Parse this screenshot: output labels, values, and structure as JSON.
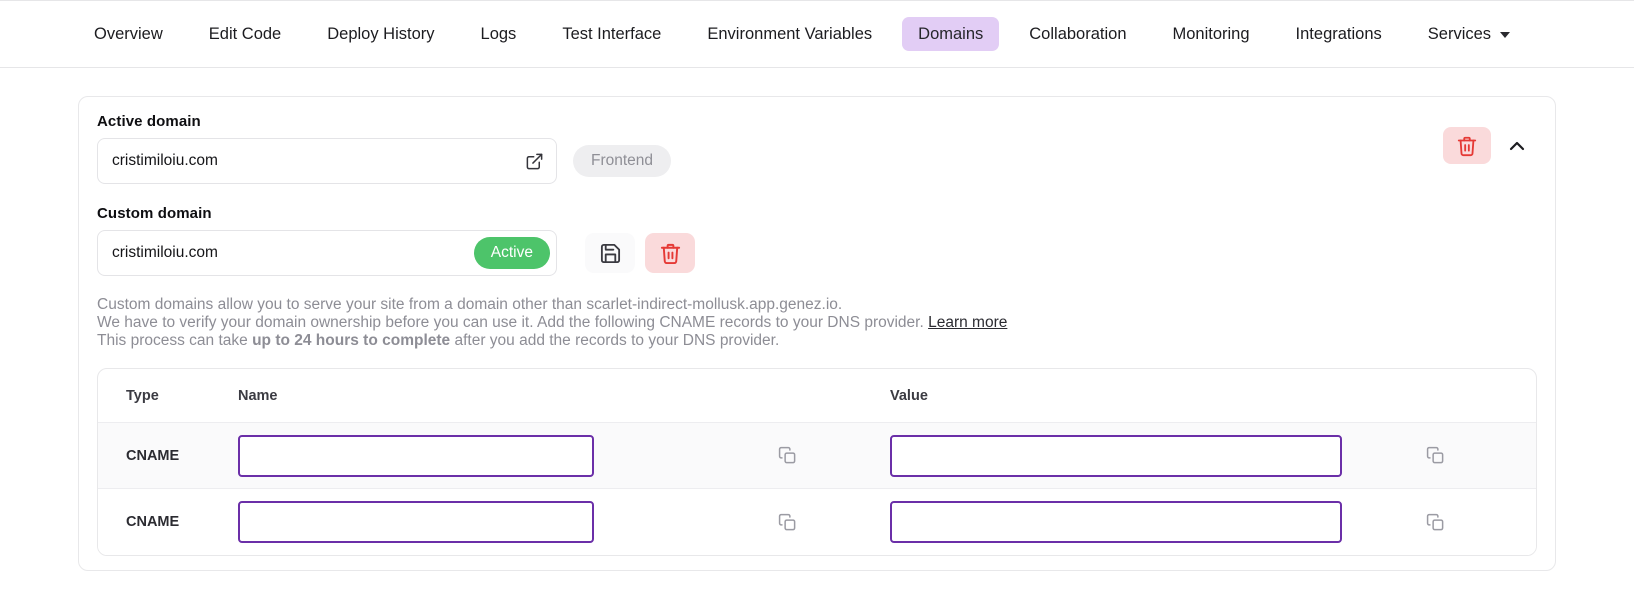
{
  "nav": {
    "items": [
      {
        "label": "Overview",
        "active": false
      },
      {
        "label": "Edit Code",
        "active": false
      },
      {
        "label": "Deploy History",
        "active": false
      },
      {
        "label": "Logs",
        "active": false
      },
      {
        "label": "Test Interface",
        "active": false
      },
      {
        "label": "Environment Variables",
        "active": false
      },
      {
        "label": "Domains",
        "active": true
      },
      {
        "label": "Collaboration",
        "active": false
      },
      {
        "label": "Monitoring",
        "active": false
      },
      {
        "label": "Integrations",
        "active": false
      },
      {
        "label": "Services",
        "active": false
      }
    ],
    "active_tab": "Domains",
    "active_tab_color": "#e2cdf5"
  },
  "active_domain": {
    "label": "Active domain",
    "value": "cristimiloiu.com",
    "badge": "Frontend",
    "badge_color": "#eeeef0",
    "external_link_icon": "external-link-icon",
    "delete_icon": "trash-icon",
    "collapse_icon": "chevron-up-icon",
    "delete_button_color": "#fadadb",
    "delete_icon_color": "#e53935"
  },
  "custom_domain": {
    "label": "Custom domain",
    "value": "cristimiloiu.com",
    "status_badge": "Active",
    "status_color": "#4dc46a",
    "save_icon": "save-icon",
    "delete_icon": "trash-icon"
  },
  "description": {
    "line1": "Custom domains allow you to serve your site from a domain other than scarlet-indirect-mollusk.app.genez.io.",
    "line2_prefix": "We have to verify your domain ownership before you can use it. Add the following CNAME records to your DNS provider. ",
    "line2_link": "Learn more",
    "line3_prefix": "This process can take ",
    "line3_bold": "up to 24 hours to complete",
    "line3_suffix": " after you add the records to your DNS provider."
  },
  "records_table": {
    "columns": [
      "Type",
      "Name",
      "Value"
    ],
    "rows": [
      {
        "type": "CNAME",
        "name": "",
        "value": "",
        "copy_name_icon": "copy-icon",
        "copy_value_icon": "copy-icon"
      },
      {
        "type": "CNAME",
        "name": "",
        "value": "",
        "copy_name_icon": "copy-icon",
        "copy_value_icon": "copy-icon"
      }
    ],
    "input_border_color": "#6b2fa8"
  }
}
